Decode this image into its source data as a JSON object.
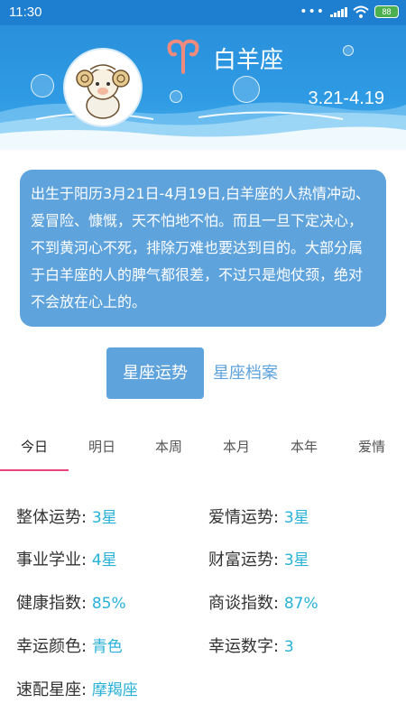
{
  "status_bar": {
    "time": "11:30",
    "battery": "88",
    "dots": "•••"
  },
  "header": {
    "sign_name": "白羊座",
    "date_range": "3.21-4.19"
  },
  "description": "出生于阳历3月21日-4月19日,白羊座的人热情冲动、爱冒险、慷慨，天不怕地不怕。而且一旦下定决心，不到黄河心不死，排除万难也要达到目的。大部分属于白羊座的人的脾气都很差，不过只是炮仗颈，绝对不会放在心上的。",
  "toggle": {
    "active": "星座运势",
    "inactive": "星座档案"
  },
  "tabs": [
    "今日",
    "明日",
    "本周",
    "本月",
    "本年",
    "爱情"
  ],
  "fortune": {
    "overall_label": "整体运势:",
    "overall_value": "3星",
    "love_label": "爱情运势:",
    "love_value": "3星",
    "career_label": "事业学业:",
    "career_value": "4星",
    "wealth_label": "财富运势:",
    "wealth_value": "3星",
    "health_label": "健康指数:",
    "health_value": "85%",
    "negotiation_label": "商谈指数:",
    "negotiation_value": "87%",
    "lucky_color_label": "幸运颜色:",
    "lucky_color_value": "青色",
    "lucky_number_label": "幸运数字:",
    "lucky_number_value": "3",
    "match_label": "速配星座:",
    "match_value": "摩羯座"
  },
  "colors": {
    "status_bar": "#1e7fd0",
    "header": "#2f9be4",
    "card": "#5fa3dd",
    "accent_value": "#27b1d9",
    "tab_indicator": "#e8457b",
    "aries_symbol": "#f08a7c"
  },
  "icons": [
    "signal-icon",
    "wifi-icon",
    "battery-icon",
    "aries-symbol-icon",
    "ram-avatar"
  ]
}
